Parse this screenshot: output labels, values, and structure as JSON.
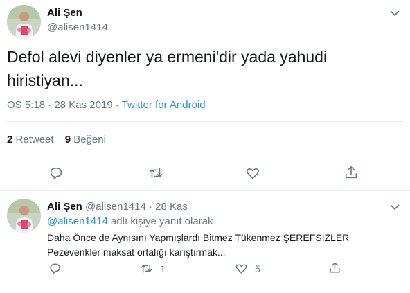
{
  "main_tweet": {
    "author_name": "Ali Şen",
    "author_handle": "@alisen1414",
    "text": "Defol alevi diyenler ya ermeni'dir yada yahudi hiristiyan...",
    "time": "ÖS 5:18",
    "separator": " · ",
    "date": "28 Kas 2019",
    "source": "Twitter for Android",
    "retweet_count": "2",
    "retweet_label": "Retweet",
    "like_count": "9",
    "like_label": "Beğeni",
    "icons": [
      "reply-icon",
      "retweet-icon",
      "like-icon",
      "share-icon"
    ]
  },
  "reply_tweet": {
    "author_name": "Ali Şen",
    "author_handle": "@alisen1414",
    "separator": " · ",
    "date": "28 Kas",
    "reply_to_mention": "@alisen1414",
    "reply_to_suffix": " adlı kişiye yanıt olarak",
    "text_line1": "Daha Önce de Aynısını Yapmışlardı Bitmez Tükenmez ŞEREFSİZLER",
    "text_line2": "Pezevenkler maksat ortalığı karıştırmak...",
    "retweet_count": "1",
    "like_count": "5",
    "icons": [
      "reply-icon",
      "retweet-icon",
      "like-icon",
      "share-icon"
    ]
  },
  "colors": {
    "text": "#14171a",
    "secondary": "#657786",
    "link": "#1b95e0",
    "border": "#e6ecf0"
  }
}
